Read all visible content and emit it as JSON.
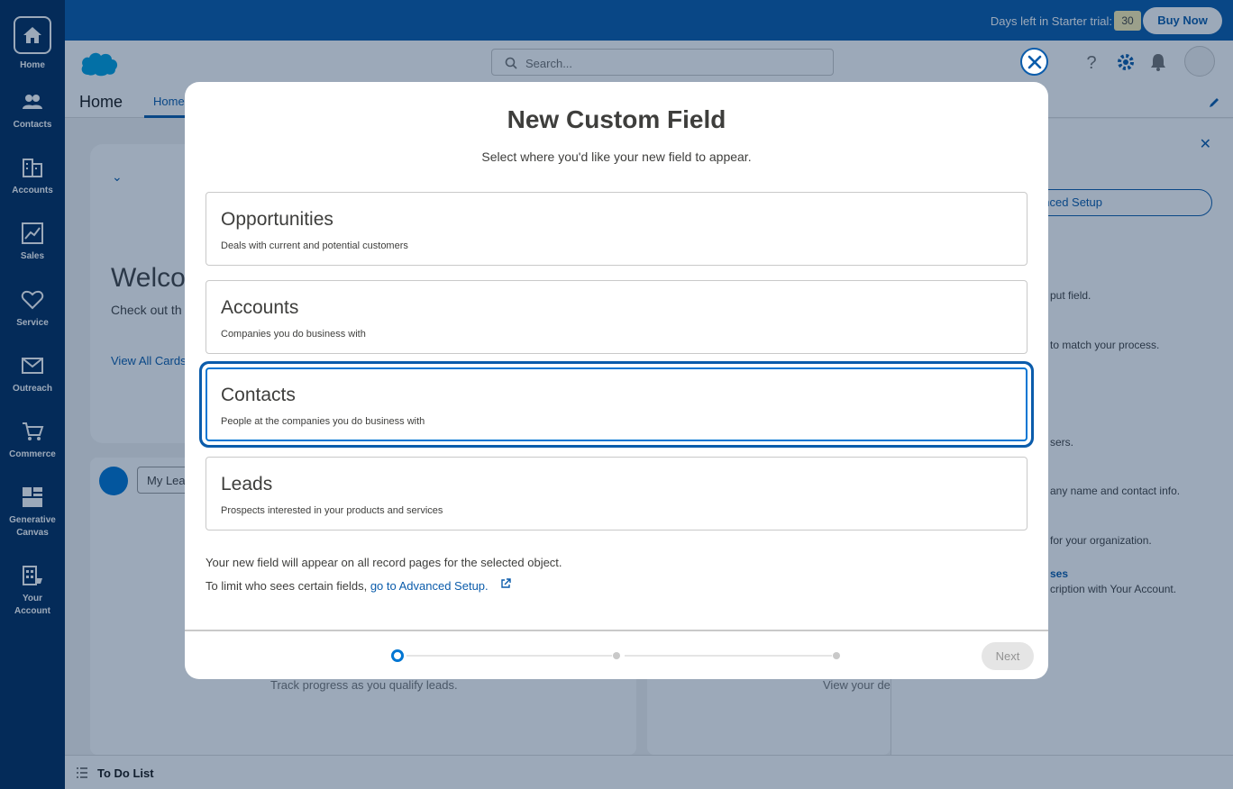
{
  "rail": {
    "items": [
      {
        "label": "Home",
        "icon": "home-icon"
      },
      {
        "label": "Contacts",
        "icon": "contacts-icon"
      },
      {
        "label": "Accounts",
        "icon": "accounts-icon"
      },
      {
        "label": "Sales",
        "icon": "sales-icon"
      },
      {
        "label": "Service",
        "icon": "heart-icon"
      },
      {
        "label": "Outreach",
        "icon": "mail-icon"
      },
      {
        "label": "Commerce",
        "icon": "cart-icon"
      },
      {
        "label_line1": "Generative",
        "label_line2": "Canvas",
        "icon": "canvas-icon"
      },
      {
        "label_line1": "Your",
        "label_line2": "Account",
        "icon": "building-icon"
      }
    ]
  },
  "trial": {
    "text": "Days left in Starter trial:",
    "days": "30",
    "buy_label": "Buy Now"
  },
  "header": {
    "search_placeholder": "Search...",
    "page_title": "Home",
    "tab_label": "Home"
  },
  "background": {
    "welcome_title": "Welco",
    "welcome_sub": "Check out th",
    "view_all": "View All Cards",
    "my_leads": "My Leads",
    "track_text": "Track progress as you qualify leads.",
    "view_your": "View your de",
    "todo_label": "To Do List",
    "right_panel": {
      "setup_button": "anced Setup",
      "lines": [
        "put field.",
        "to match your process.",
        "sers.",
        "any name and contact info.",
        "for your organization.",
        "ses",
        "cription with Your Account."
      ]
    }
  },
  "modal": {
    "title": "New Custom Field",
    "subtitle": "Select where you'd like your new field to appear.",
    "options": [
      {
        "title": "Opportunities",
        "description": "Deals with current and potential customers",
        "selected": false
      },
      {
        "title": "Accounts",
        "description": "Companies you do business with",
        "selected": false
      },
      {
        "title": "Contacts",
        "description": "People at the companies you do business with",
        "selected": true
      },
      {
        "title": "Leads",
        "description": "Prospects interested in your products and services",
        "selected": false
      }
    ],
    "note_line1": "Your new field will appear on all record pages for the selected object.",
    "note_line2_prefix": "To limit who sees certain fields,",
    "note_line2_link": "go to Advanced Setup.",
    "progress": {
      "current_step": 1,
      "total_steps": 3
    },
    "next_label": "Next"
  },
  "colors": {
    "brand_blue": "#0b5cab",
    "rail_bg": "#032d60",
    "accent": "#0176d3"
  }
}
